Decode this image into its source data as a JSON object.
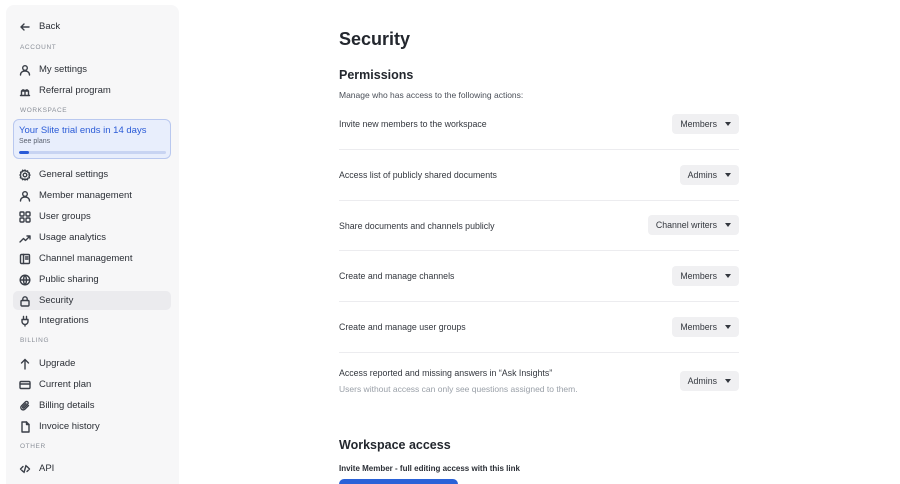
{
  "sidebar": {
    "back_label": "Back",
    "sections": {
      "account": "ACCOUNT",
      "workspace": "WORKSPACE",
      "billing": "BILLING",
      "other": "OTHER"
    },
    "account_items": [
      {
        "label": "My settings",
        "icon": "user-icon"
      },
      {
        "label": "Referral program",
        "icon": "gift-icon"
      }
    ],
    "trial": {
      "title": "Your Slite trial ends in 14 days",
      "link": "See plans",
      "progress_fraction": 0.07
    },
    "workspace_items": [
      {
        "label": "General settings",
        "icon": "gear-icon"
      },
      {
        "label": "Member management",
        "icon": "user-icon"
      },
      {
        "label": "User groups",
        "icon": "users-icon"
      },
      {
        "label": "Usage analytics",
        "icon": "trend-icon"
      },
      {
        "label": "Channel management",
        "icon": "channel-icon"
      },
      {
        "label": "Public sharing",
        "icon": "globe-icon"
      },
      {
        "label": "Security",
        "icon": "lock-icon",
        "active": true
      },
      {
        "label": "Integrations",
        "icon": "plug-icon"
      }
    ],
    "billing_items": [
      {
        "label": "Upgrade",
        "icon": "arrow-up-icon"
      },
      {
        "label": "Current plan",
        "icon": "card-icon"
      },
      {
        "label": "Billing details",
        "icon": "paperclip-icon"
      },
      {
        "label": "Invoice history",
        "icon": "document-icon"
      }
    ],
    "other_items": [
      {
        "label": "API",
        "icon": "code-icon"
      }
    ]
  },
  "main": {
    "title": "Security",
    "permissions": {
      "heading": "Permissions",
      "description": "Manage who has access to the following actions:",
      "rows": [
        {
          "label": "Invite new members to the workspace",
          "value": "Members"
        },
        {
          "label": "Access list of publicly shared documents",
          "value": "Admins"
        },
        {
          "label": "Share documents and channels publicly",
          "value": "Channel writers"
        },
        {
          "label": "Create and manage channels",
          "value": "Members"
        },
        {
          "label": "Create and manage user groups",
          "value": "Members"
        },
        {
          "label": "Access reported and missing answers in “Ask Insights”",
          "sublabel": "Users without access can only see questions assigned to them.",
          "value": "Admins"
        }
      ]
    },
    "workspace_access": {
      "heading": "Workspace access",
      "invite_label": "Invite Member - full editing access with this link"
    }
  },
  "colors": {
    "accent": "#2a5bd7",
    "sidebar_bg": "#f7f7f8",
    "active_item_bg": "#ebebee",
    "select_bg": "#f0f0f2"
  }
}
